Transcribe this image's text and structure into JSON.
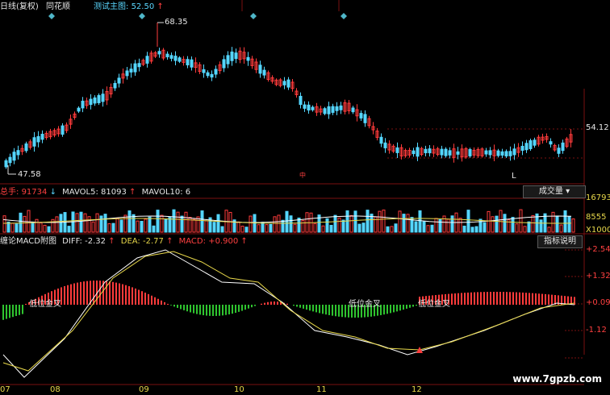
{
  "header": {
    "title": "日线(复权)",
    "app": "同花顺",
    "indicator_name": "测试主图:",
    "indicator_value": "52.50",
    "indicator_arrow": "↑"
  },
  "price_panel": {
    "high_label": "68.35",
    "low_label": "47.58",
    "right_axis_value": "54.12",
    "marker_L": "L",
    "marker_mid": "中"
  },
  "volume_panel": {
    "total_label": "总手:",
    "total_value": "91734",
    "total_arrow": "↓",
    "mavol5_label": "MAVOL5:",
    "mavol5_value": "81093",
    "mavol5_arrow": "↑",
    "mavol10_label": "MAVOL10:",
    "mavol10_value": "6",
    "button_label": "成交量",
    "button_caret": "▾",
    "axis": [
      "16793",
      "8555",
      "X1000"
    ]
  },
  "macd_panel": {
    "title": "缠论MACD附图",
    "diff_label": "DIFF:",
    "diff_value": "-2.32",
    "diff_arrow": "↑",
    "dea_label": "DEA:",
    "dea_value": "-2.77",
    "dea_arrow": "↑",
    "macd_label": "MACD:",
    "macd_value": "+0.900",
    "macd_arrow": "↑",
    "button_label": "指标说明",
    "axis": [
      "+2.54",
      "+1.32",
      "+0.09",
      "-1.12"
    ],
    "annotations": [
      "低位金叉",
      "低位金叉",
      "低位金叉"
    ]
  },
  "dates": [
    "07",
    "08",
    "09",
    "10",
    "11",
    "12"
  ],
  "watermark": "www.7gpzb.com",
  "colors": {
    "up": "#ff3b3b",
    "down": "#54d6ff",
    "diff_line": "#ffffff",
    "dea_line": "#e8d84a",
    "grid": "#7a1010",
    "macd_neg": "#2fc42f"
  }
}
